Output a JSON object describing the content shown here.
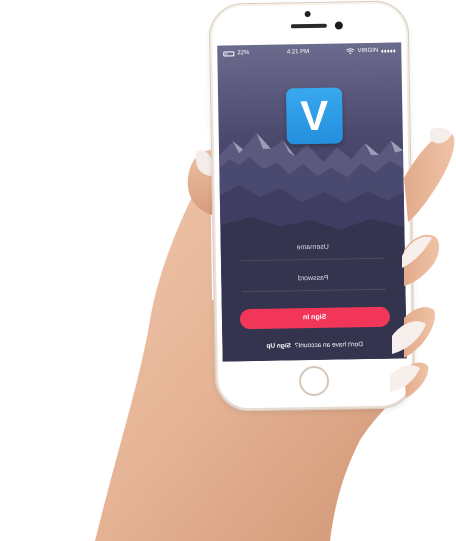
{
  "status_bar": {
    "battery": "22%",
    "time": "4:21 PM",
    "carrier": "VIRGIN"
  },
  "logo": {
    "letter": "V",
    "color": "#2f9ae6"
  },
  "form": {
    "username_placeholder": "Username",
    "password_placeholder": "Password",
    "sign_in_label": "Sign In",
    "sign_in_color": "#f2365a",
    "signup_prompt": "Don't have an account?",
    "signup_link": "Sign Up"
  },
  "icons": [
    "battery-icon",
    "wifi-icon",
    "signal-icon",
    "home-button"
  ]
}
